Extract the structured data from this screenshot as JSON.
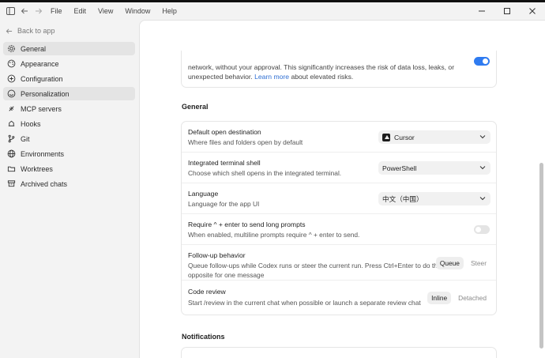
{
  "menu": [
    "File",
    "Edit",
    "View",
    "Window",
    "Help"
  ],
  "sidebar": {
    "back_label": "Back to app",
    "items": [
      {
        "label": "General",
        "icon": "gear-icon",
        "active": true
      },
      {
        "label": "Appearance",
        "icon": "palette-icon",
        "active": false
      },
      {
        "label": "Configuration",
        "icon": "settings-icon",
        "active": false
      },
      {
        "label": "Personalization",
        "icon": "sparkle-icon",
        "active": true
      },
      {
        "label": "MCP servers",
        "icon": "plug-icon",
        "active": false
      },
      {
        "label": "Hooks",
        "icon": "hook-icon",
        "active": false
      },
      {
        "label": "Git",
        "icon": "git-branch-icon",
        "active": false
      },
      {
        "label": "Environments",
        "icon": "globe-icon",
        "active": false
      },
      {
        "label": "Worktrees",
        "icon": "folder-tree-icon",
        "active": false
      },
      {
        "label": "Archived chats",
        "icon": "archive-icon",
        "active": false
      }
    ]
  },
  "warning": {
    "text": "network, without your approval. This significantly increases the risk of data loss, leaks, or unexpected behavior.",
    "link": "Learn more",
    "text_after": "about elevated risks.",
    "enabled": true
  },
  "general": {
    "title": "General",
    "rows": {
      "open_destination": {
        "title": "Default open destination",
        "desc": "Where files and folders open by default",
        "value": "Cursor"
      },
      "terminal": {
        "title": "Integrated terminal shell",
        "desc": "Choose which shell opens in the integrated terminal.",
        "value": "PowerShell"
      },
      "language": {
        "title": "Language",
        "desc": "Language for the app UI",
        "value": "中文（中国）"
      },
      "long_prompts": {
        "title": "Require ^ + enter to send long prompts",
        "desc": "When enabled, multiline prompts require ^ + enter to send.",
        "enabled": false
      },
      "followup": {
        "title": "Follow-up behavior",
        "desc_1": "Queue follow-ups while Codex runs or steer the current run. Press Ctrl+Enter to do the",
        "desc_2": "opposite for one message",
        "opt_a": "Queue",
        "opt_b": "Steer"
      },
      "code_review": {
        "title": "Code review",
        "desc": "Start /review in the current chat when possible or launch a separate review chat",
        "opt_a": "Inline",
        "opt_b": "Detached"
      }
    }
  },
  "notifications": {
    "title": "Notifications"
  },
  "colors": {
    "accent": "#2f7bf0",
    "link": "#2f6fd3"
  }
}
